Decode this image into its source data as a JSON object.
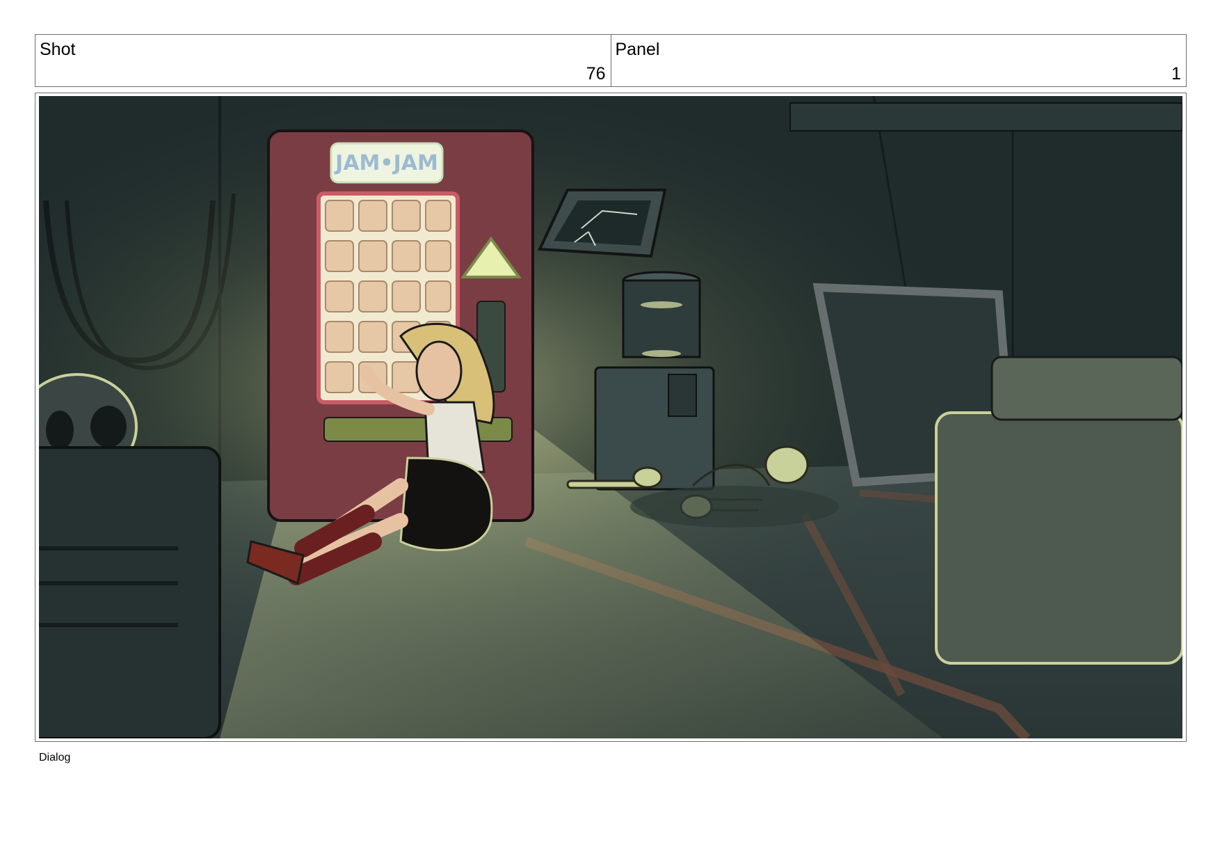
{
  "header": {
    "shot": {
      "label": "Shot",
      "value": "76"
    },
    "panel": {
      "label": "Panel",
      "value": "1"
    }
  },
  "scene": {
    "sign_text": "JAM•JAM"
  },
  "footer": {
    "dialog_label": "Dialog"
  }
}
